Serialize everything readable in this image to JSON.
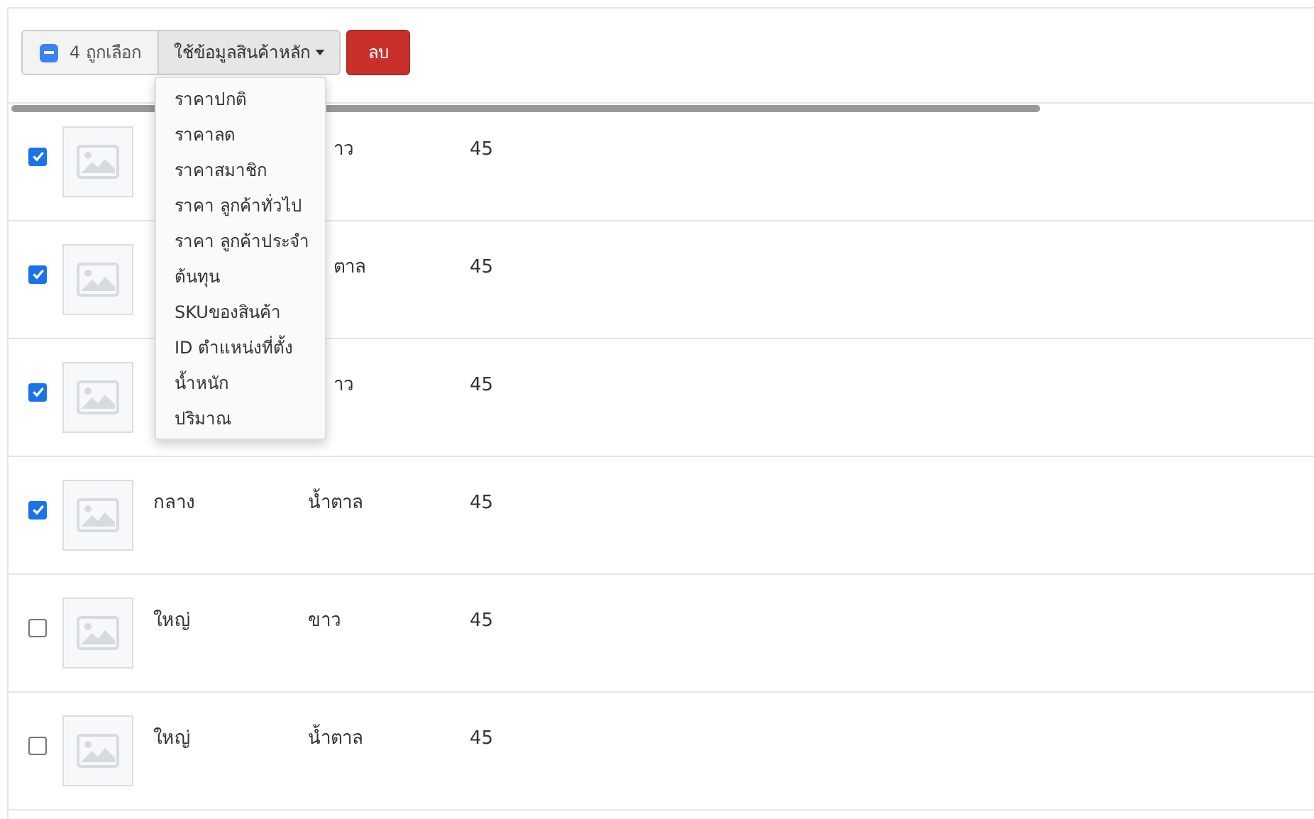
{
  "toolbar": {
    "selection": {
      "indeterminate": true,
      "label": "4 ถูกเลือก"
    },
    "dropdown": {
      "label": "ใช้ข้อมูลสินค้าหลัก",
      "expanded": true,
      "items": [
        {
          "label": "ราคาปกติ"
        },
        {
          "label": "ราคาลด"
        },
        {
          "label": "ราคาสมาชิก"
        },
        {
          "label": "ราคา ลูกค้าทั่วไป"
        },
        {
          "label": "ราคา ลูกค้าประจำ"
        },
        {
          "label": "ต้นทุน"
        },
        {
          "label": "SKUของสินค้า"
        },
        {
          "label": "ID ตำแหน่งที่ตั้ง"
        },
        {
          "label": "น้ำหนัก"
        },
        {
          "label": "ปริมาณ"
        }
      ]
    },
    "delete_button": "ลบ"
  },
  "rows": [
    {
      "checked": true,
      "shade": "าว",
      "quantity": "45"
    },
    {
      "checked": true,
      "shade": "ตาล",
      "quantity": "45"
    },
    {
      "checked": true,
      "shade": "าว",
      "quantity": "45"
    },
    {
      "checked": true,
      "size": "กลาง",
      "shade": "น้ำตาล",
      "quantity": "45"
    },
    {
      "checked": false,
      "size": "ใหญ่",
      "shade": "ขาว",
      "quantity": "45"
    },
    {
      "checked": false,
      "size": "ใหญ่",
      "shade": "น้ำตาล",
      "quantity": "45"
    }
  ]
}
